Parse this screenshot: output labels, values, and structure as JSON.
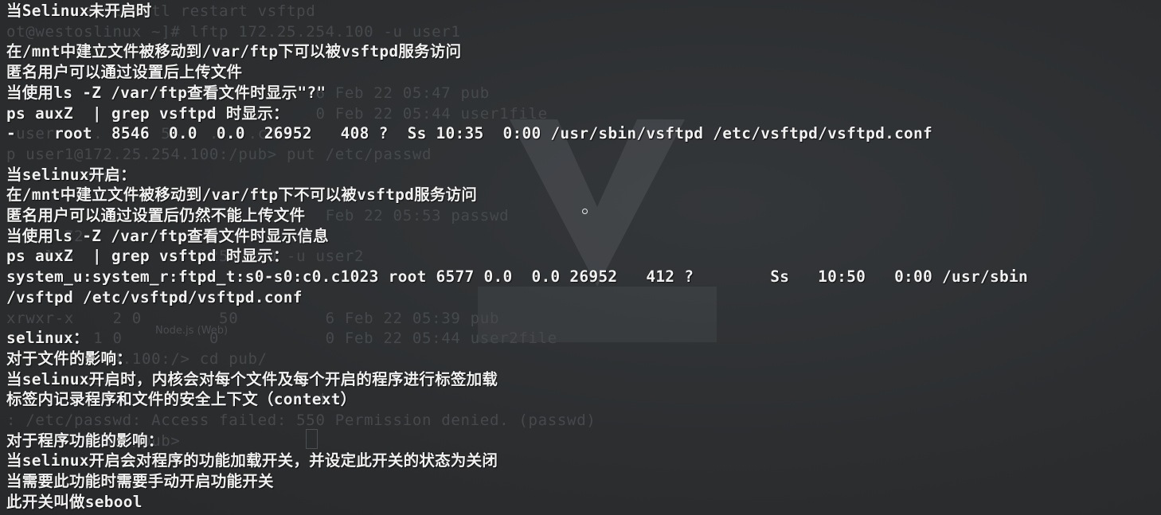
{
  "terminal": {
    "background_lines": [
      "     .  systemctl restart vsftpd",
      "ot@westoslinux ~]# lftp 172.25.254.100 -u user1",
      "",
      "",
      "                                6 Feb 22 05:47 pub",
      "     .                          0 Feb 22 05:44 user1file",
      "-user    .   .  54   .   .cd",
      "p user1@172.25.254.100:/pub> put /etc/passwd",
      "        rred",
      "",
      "                                 Feb 22 05:53 passwd",
      "  t   72",
      "   slin         .    254.100 -u user2",
      "",
      "",
      "xrwxr-x    2 0        50         6 Feb 22 05:39 pub",
      "         1 0         0           0 Feb 22 05:44 user2file",
      "          54.100:/> cd pub/",
      "        .54",
      "                                d",
      ": /etc/passwd: Access failed: 550 Permission denied. (passwd)",
      "          00:/pub>",
      "",
      "",
      ""
    ],
    "overlay_lines": [
      "当Selinux未开启时",
      "",
      "在/mnt中建立文件被移动到/var/ftp下可以被vsftpd服务访问",
      "匿名用户可以通过设置后上传文件",
      "当使用ls -Z /var/ftp查看文件时显示\"?\"",
      "ps auxZ  | grep vsftpd 时显示：",
      "-    root  8546  0.0  0.0  26952   408 ?  Ss 10:35  0:00 /usr/sbin/vsftpd /etc/vsftpd/vsftpd.conf",
      "",
      "当selinux开启：",
      "在/mnt中建立文件被移动到/var/ftp下不可以被vsftpd服务访问",
      "匿名用户可以通过设置后仍然不能上传文件",
      "当使用ls -Z /var/ftp查看文件时显示信息",
      "ps auxZ  | grep vsftpd 时显示：",
      "system_u:system_r:ftpd_t:s0-s0:c0.c1023 root 6577 0.0  0.0 26952   412 ?        Ss   10:50   0:00 /usr/sbin",
      "/vsftpd /etc/vsftpd/vsftpd.conf",
      "",
      "selinux：",
      "对于文件的影响：",
      "当selinux开启时，内核会对每个文件及每个开启的程序进行标签加载",
      "标签内记录程序和文件的安全上下文（context）",
      "",
      "对于程序功能的影响：",
      "当selinux开启会对程序的功能加载开关，并设定此开关的状态为关闭",
      "当需要此功能时需要手动开启功能开关",
      "此开关叫做sebool"
    ],
    "ghost_label": "Node.js (Web)"
  },
  "colors": {
    "background": "#2b2d2f",
    "overlay_text": "#f1f1f1",
    "faded_text": "#46494c"
  },
  "icons": {
    "watermark": "logo-watermark-icon",
    "cursor": "terminal-cursor-icon"
  }
}
